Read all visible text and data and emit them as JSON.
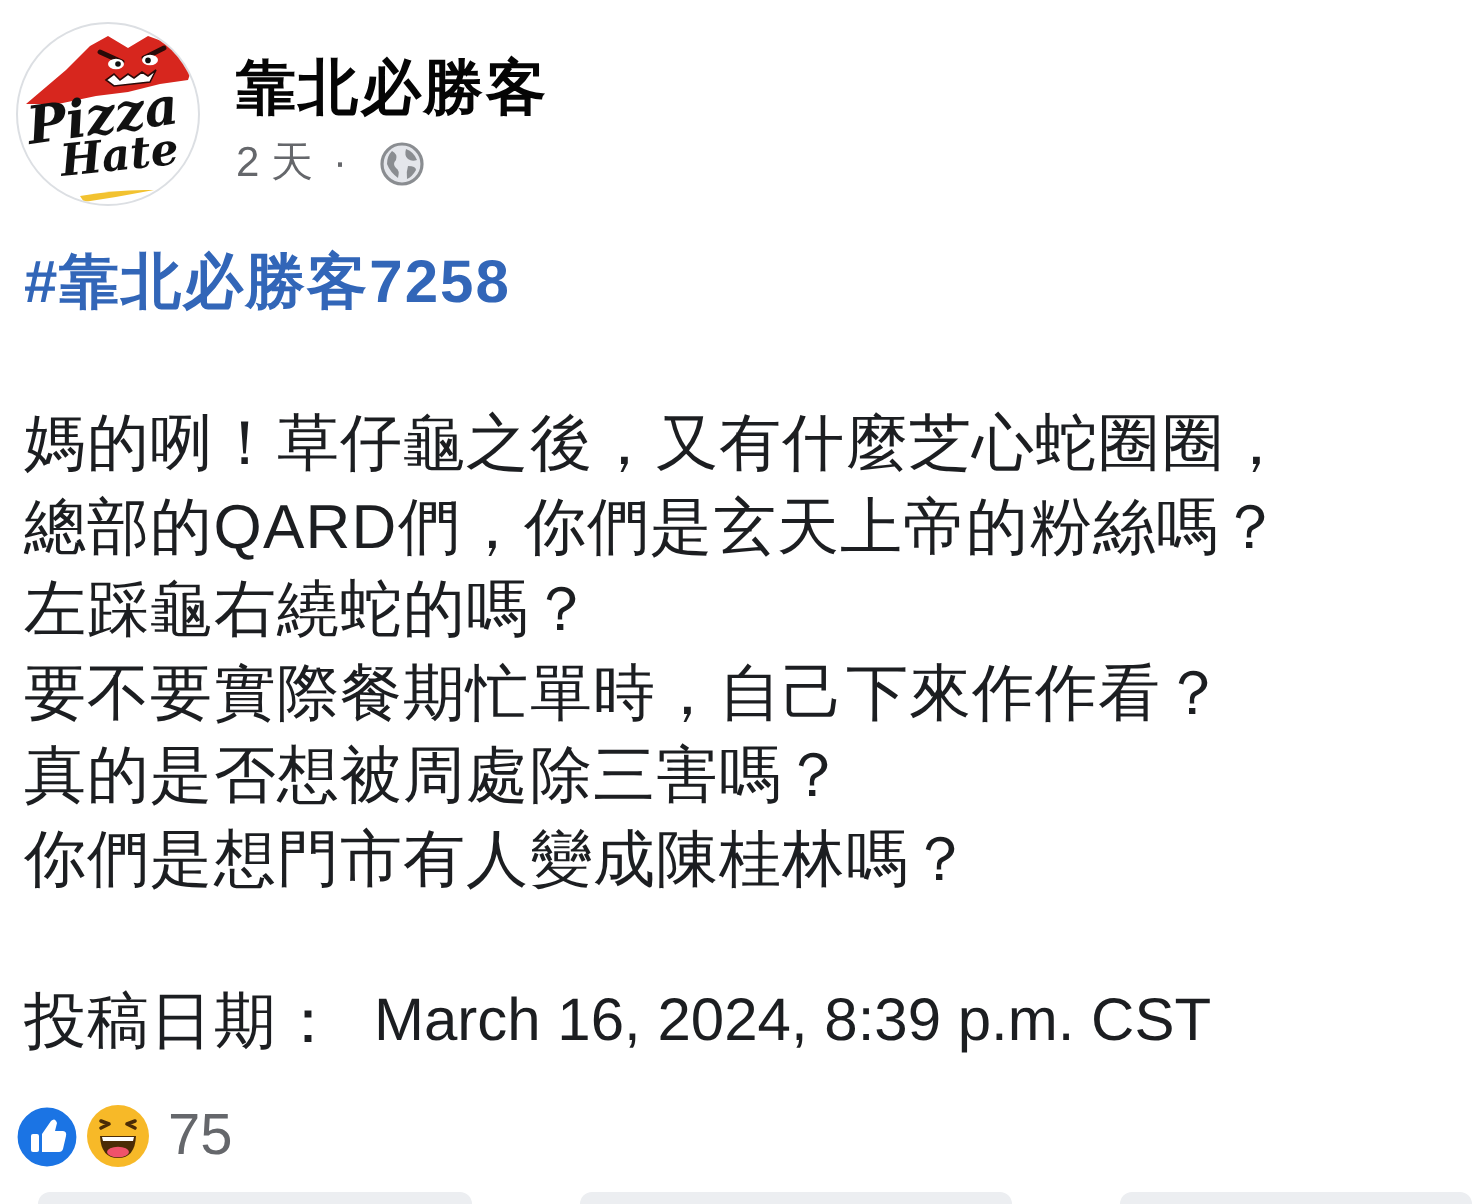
{
  "post": {
    "author": {
      "avatar_logo_text": [
        "Pizza",
        "Hate"
      ],
      "name": "靠北必勝客",
      "time": "2 天",
      "separator": "·"
    },
    "hashtag": "#靠北必勝客7258",
    "body_lines": [
      "媽的咧！草仔龜之後，又有什麼芝心蛇圈圈，",
      "總部的QARD們，你們是玄天上帝的粉絲嗎？",
      "左踩龜右繞蛇的嗎？",
      "要不要實際餐期忙單時，自己下來作作看？",
      "真的是否想被周處除三害嗎？",
      "你們是想門市有人變成陳桂林嗎？"
    ],
    "posted": {
      "label": "投稿日期：",
      "value": "March 16, 2024, 8:39 p.m. CST"
    },
    "reactions": {
      "items": [
        {
          "kind": "like"
        },
        {
          "kind": "haha"
        }
      ],
      "count": "75"
    }
  }
}
